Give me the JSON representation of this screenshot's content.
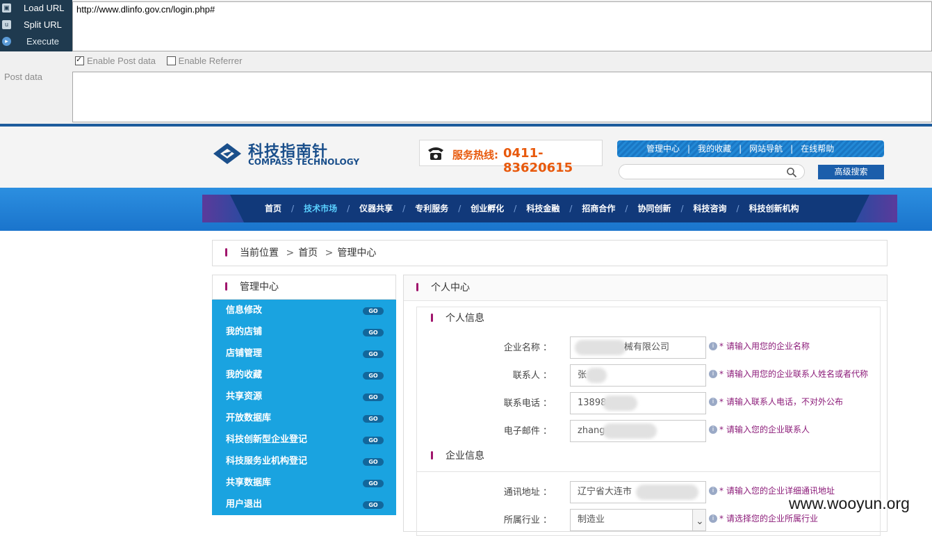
{
  "hackbar": {
    "menu": [
      {
        "label": "Load URL",
        "icon": "load-url-icon"
      },
      {
        "label": "Split URL",
        "icon": "split-url-icon"
      },
      {
        "label": "Execute",
        "icon": "execute-icon"
      }
    ],
    "url": "http://www.dlinfo.gov.cn/login.php#",
    "options": [
      {
        "label": "Enable Post data",
        "checked": true
      },
      {
        "label": "Enable Referrer",
        "checked": false
      }
    ],
    "post_label": "Post data",
    "post_value": ""
  },
  "header": {
    "logo_cn": "科技指南针",
    "logo_en": "COMPASS TECHNOLOGY",
    "hotline_label": "服务热线:",
    "hotline_number": "0411-83620615",
    "top_links": [
      "管理中心",
      "我的收藏",
      "网站导航",
      "在线帮助"
    ],
    "separator": "|",
    "search_placeholder": "",
    "advanced_search": "高级搜索",
    "brand_color": "#1a4f8b",
    "accent_color": "#e8590c"
  },
  "nav": {
    "items": [
      "首页",
      "技术市场",
      "仪器共享",
      "专利服务",
      "创业孵化",
      "科技金融",
      "招商合作",
      "协同创新",
      "科技咨询",
      "科技创新机构"
    ],
    "active": "技术市场",
    "slash": "/"
  },
  "breadcrumb": {
    "label": "当前位置",
    "items": [
      "首页",
      "管理中心"
    ],
    "gt": ">"
  },
  "sidebar": {
    "title": "管理中心",
    "items": [
      {
        "label": "信息修改",
        "go": "GO"
      },
      {
        "label": "我的店铺",
        "go": "GO"
      },
      {
        "label": "店铺管理",
        "go": "GO"
      },
      {
        "label": "我的收藏",
        "go": "GO"
      },
      {
        "label": "共享资源",
        "go": "GO"
      },
      {
        "label": "开放数据库",
        "go": "GO"
      },
      {
        "label": "科技创新型企业登记",
        "go": "GO"
      },
      {
        "label": "科技服务业机构登记",
        "go": "GO"
      },
      {
        "label": "共享数据库",
        "go": "GO"
      },
      {
        "label": "用户退出",
        "go": "GO"
      }
    ]
  },
  "panel": {
    "title": "个人中心",
    "section1": "个人信息",
    "section2": "企业信息",
    "fields": [
      {
        "label": "企业名称 ：",
        "value": "械有限公司",
        "hint": "请输入用您的企业名称"
      },
      {
        "label": "联系人 ：",
        "value": "张",
        "hint": "请输入用您的企业联系人姓名或者代称"
      },
      {
        "label": "联系电话 ：",
        "value": "13898",
        "hint": "请输入联系人电话，不对外公布"
      },
      {
        "label": "电子邮件 ：",
        "value": "zhang",
        "hint": "请输入您的企业联系人"
      },
      {
        "label": "通讯地址 ：",
        "value": "辽宁省大连市",
        "hint": "请输入您的企业详细通讯地址"
      },
      {
        "label": "所属行业 ：",
        "value": "制造业",
        "hint": "请选择您的企业所属行业"
      }
    ],
    "required_mark": "*",
    "hint_color": "#8b1a78"
  },
  "watermark": "www.wooyun.org"
}
